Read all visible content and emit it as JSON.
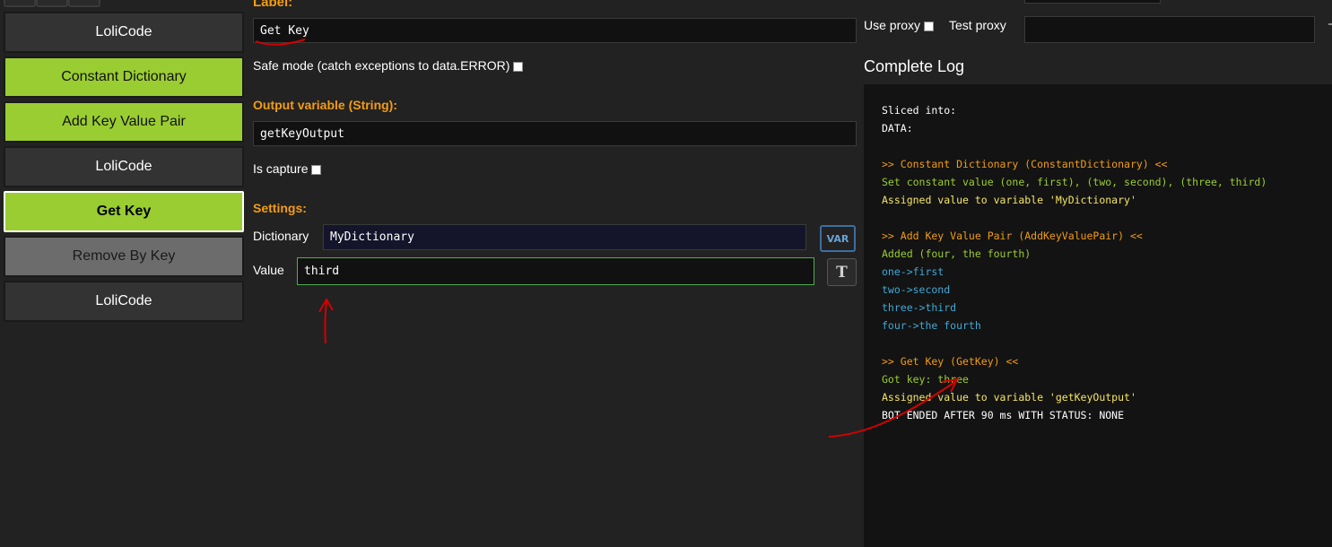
{
  "blocks": [
    {
      "label": "LoliCode",
      "style": "dark"
    },
    {
      "label": "Constant Dictionary",
      "style": "green"
    },
    {
      "label": "Add Key Value Pair",
      "style": "green"
    },
    {
      "label": "LoliCode",
      "style": "dark"
    },
    {
      "label": "Get Key",
      "style": "green",
      "selected": true
    },
    {
      "label": "Remove By Key",
      "style": "gray"
    },
    {
      "label": "LoliCode",
      "style": "dark"
    }
  ],
  "editor": {
    "label_title": "Label:",
    "label_value": "Get Key",
    "safe_mode_label": "Safe mode (catch exceptions to data.ERROR)",
    "output_title": "Output variable (String):",
    "output_value": "getKeyOutput",
    "is_capture_label": "Is capture",
    "settings_title": "Settings:",
    "dictionary_label": "Dictionary",
    "dictionary_value": "MyDictionary",
    "var_button": "VAR",
    "value_label": "Value",
    "value_value": "third",
    "text_mode_button": "T"
  },
  "proxy": {
    "use_proxy_label": "Use proxy",
    "test_proxy_label": "Test proxy",
    "test_proxy_value": ""
  },
  "log": {
    "title": "Complete Log",
    "lines": [
      {
        "text": "Sliced into:",
        "color": "#ffffff"
      },
      {
        "text": "DATA:",
        "color": "#ffffff"
      },
      {
        "text": "",
        "color": "#ffffff"
      },
      {
        "text": ">> Constant Dictionary (ConstantDictionary) <<",
        "color": "#f39c12"
      },
      {
        "text": "Set constant value (one, first), (two, second), (three, third)",
        "color": "#9acd32"
      },
      {
        "text": "Assigned value to variable 'MyDictionary'",
        "color": "#f5e663"
      },
      {
        "text": "",
        "color": "#ffffff"
      },
      {
        "text": ">> Add Key Value Pair (AddKeyValuePair) <<",
        "color": "#f39c12"
      },
      {
        "text": "Added (four, the fourth)",
        "color": "#9acd32"
      },
      {
        "text": "one->first",
        "color": "#3fa9d6"
      },
      {
        "text": "two->second",
        "color": "#3fa9d6"
      },
      {
        "text": "three->third",
        "color": "#3fa9d6"
      },
      {
        "text": "four->the fourth",
        "color": "#3fa9d6"
      },
      {
        "text": "",
        "color": "#ffffff"
      },
      {
        "text": ">> Get Key (GetKey) <<",
        "color": "#f39c12"
      },
      {
        "text": "Got key: three",
        "color": "#9acd32"
      },
      {
        "text": "Assigned value to variable 'getKeyOutput'",
        "color": "#f5e663"
      },
      {
        "text": "BOT ENDED AFTER 90 ms WITH STATUS: NONE",
        "color": "#ffffff"
      }
    ]
  },
  "colors": {
    "accent_orange": "#f39c12",
    "block_green": "#9acd32",
    "annotation_red": "#d40000"
  }
}
